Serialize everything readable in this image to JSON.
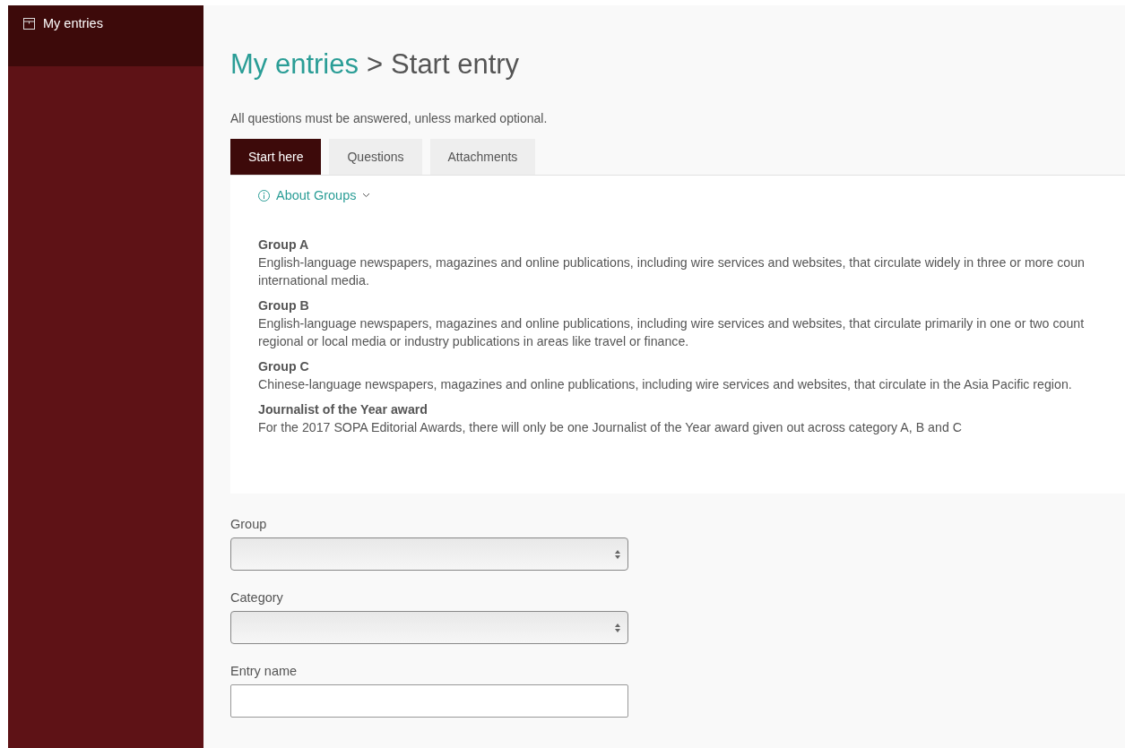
{
  "sidebar": {
    "items": [
      {
        "label": "My entries",
        "selected": true
      }
    ]
  },
  "breadcrumb": {
    "link": "My entries",
    "separator": ">",
    "current": "Start entry"
  },
  "intro": "All questions must be answered, unless marked optional.",
  "tabs": [
    {
      "label": "Start here",
      "selected": true
    },
    {
      "label": "Questions",
      "selected": false
    },
    {
      "label": "Attachments",
      "selected": false
    }
  ],
  "about": {
    "toggle": "About Groups",
    "expanded": true,
    "sections": [
      {
        "title": "Group A",
        "lines": [
          "English-language newspapers, magazines and online publications, including wire services and websites, that circulate widely in three or more coun",
          "international media."
        ]
      },
      {
        "title": "Group B",
        "lines": [
          "English-language newspapers, magazines and online publications, including wire services and websites, that circulate primarily in one or two count",
          "regional or local media or industry publications in areas like travel or finance."
        ]
      },
      {
        "title": "Group C",
        "lines": [
          "Chinese-language newspapers, magazines and online publications, including wire services and websites, that circulate in the Asia Pacific region."
        ]
      },
      {
        "title": "Journalist of the Year award",
        "lines": [
          "For the 2017 SOPA Editorial Awards, there will only be one Journalist of the Year award given out across category A, B and C"
        ]
      }
    ]
  },
  "fields": [
    {
      "label": "Group",
      "kind": "select"
    },
    {
      "label": "Category",
      "kind": "select"
    },
    {
      "label": "Entry name",
      "kind": "text"
    }
  ]
}
